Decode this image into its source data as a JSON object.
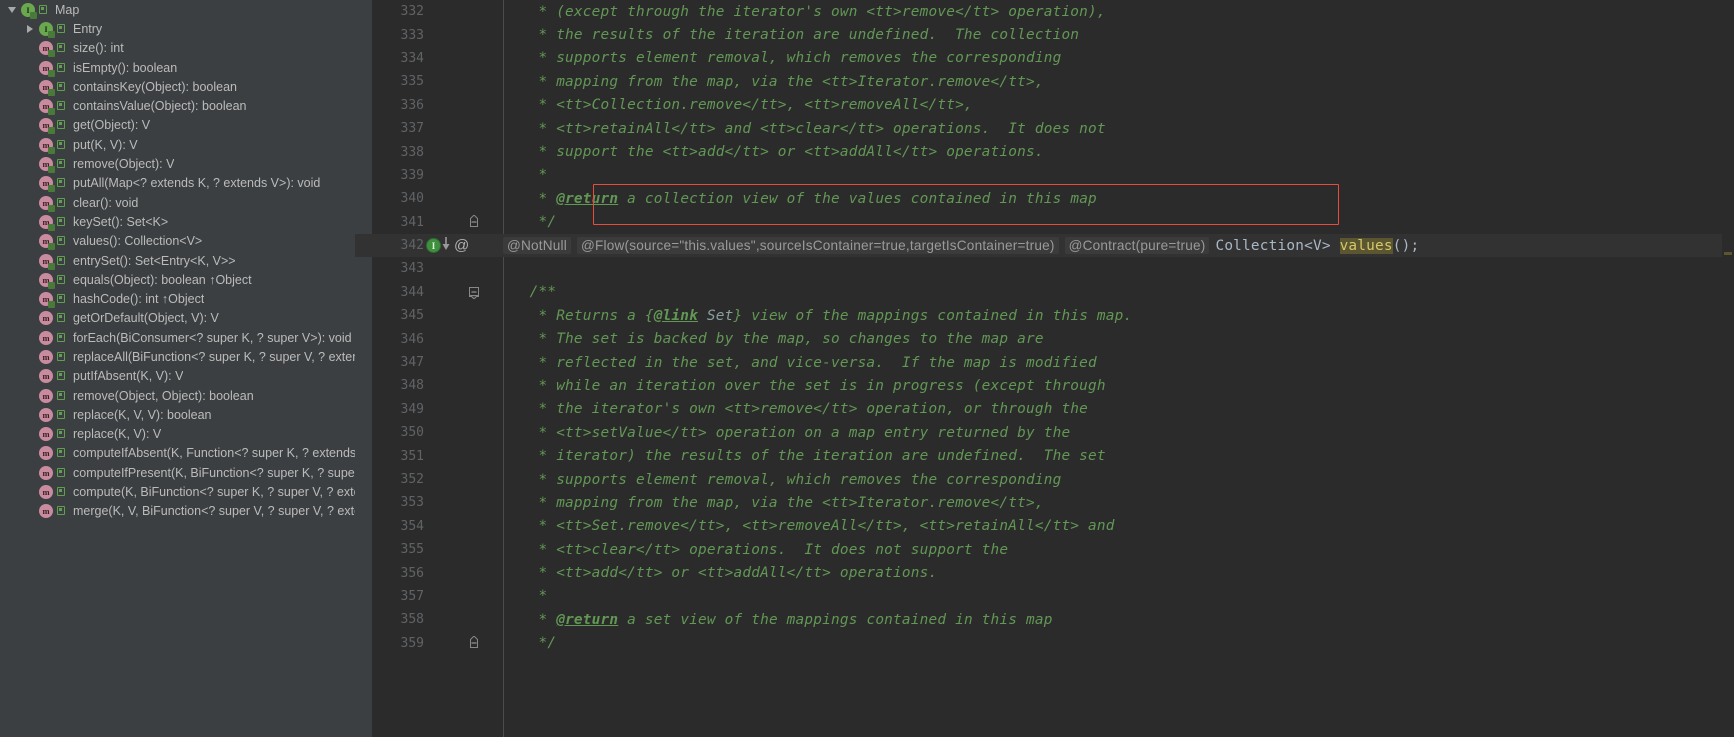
{
  "structure_panel": {
    "name": "structure-tree",
    "items": [
      {
        "indent": 0,
        "twisty": "expanded",
        "icon": "interface-icon",
        "visibility": "public-icon",
        "label": "Map"
      },
      {
        "indent": 1,
        "twisty": "collapsed",
        "icon": "interface-icon",
        "visibility": "public-icon",
        "label": "Entry"
      },
      {
        "indent": 1,
        "twisty": "none",
        "icon": "method-abstract-icon",
        "visibility": "public-icon",
        "label": "size(): int"
      },
      {
        "indent": 1,
        "twisty": "none",
        "icon": "method-abstract-icon",
        "visibility": "public-icon",
        "label": "isEmpty(): boolean"
      },
      {
        "indent": 1,
        "twisty": "none",
        "icon": "method-abstract-icon",
        "visibility": "public-icon",
        "label": "containsKey(Object): boolean"
      },
      {
        "indent": 1,
        "twisty": "none",
        "icon": "method-abstract-icon",
        "visibility": "public-icon",
        "label": "containsValue(Object): boolean"
      },
      {
        "indent": 1,
        "twisty": "none",
        "icon": "method-abstract-icon",
        "visibility": "public-icon",
        "label": "get(Object): V"
      },
      {
        "indent": 1,
        "twisty": "none",
        "icon": "method-abstract-icon",
        "visibility": "public-icon",
        "label": "put(K, V): V"
      },
      {
        "indent": 1,
        "twisty": "none",
        "icon": "method-abstract-icon",
        "visibility": "public-icon",
        "label": "remove(Object): V"
      },
      {
        "indent": 1,
        "twisty": "none",
        "icon": "method-abstract-icon",
        "visibility": "public-icon",
        "label": "putAll(Map<? extends K, ? extends V>): void"
      },
      {
        "indent": 1,
        "twisty": "none",
        "icon": "method-abstract-icon",
        "visibility": "public-icon",
        "label": "clear(): void"
      },
      {
        "indent": 1,
        "twisty": "none",
        "icon": "method-abstract-icon",
        "visibility": "public-icon",
        "label": "keySet(): Set<K>"
      },
      {
        "indent": 1,
        "twisty": "none",
        "icon": "method-abstract-icon",
        "visibility": "public-icon",
        "label": "values(): Collection<V>"
      },
      {
        "indent": 1,
        "twisty": "none",
        "icon": "method-abstract-icon",
        "visibility": "public-icon",
        "label": "entrySet(): Set<Entry<K, V>>"
      },
      {
        "indent": 1,
        "twisty": "none",
        "icon": "method-abstract-icon",
        "visibility": "public-icon",
        "label": "equals(Object): boolean ↑Object"
      },
      {
        "indent": 1,
        "twisty": "none",
        "icon": "method-abstract-icon",
        "visibility": "public-icon",
        "label": "hashCode(): int ↑Object"
      },
      {
        "indent": 1,
        "twisty": "none",
        "icon": "method-icon",
        "visibility": "public-icon",
        "label": "getOrDefault(Object, V): V"
      },
      {
        "indent": 1,
        "twisty": "none",
        "icon": "method-icon",
        "visibility": "public-icon",
        "label": "forEach(BiConsumer<? super K, ? super V>): void"
      },
      {
        "indent": 1,
        "twisty": "none",
        "icon": "method-icon",
        "visibility": "public-icon",
        "label": "replaceAll(BiFunction<? super K, ? super V, ? extends V>): void"
      },
      {
        "indent": 1,
        "twisty": "none",
        "icon": "method-icon",
        "visibility": "public-icon",
        "label": "putIfAbsent(K, V): V"
      },
      {
        "indent": 1,
        "twisty": "none",
        "icon": "method-icon",
        "visibility": "public-icon",
        "label": "remove(Object, Object): boolean"
      },
      {
        "indent": 1,
        "twisty": "none",
        "icon": "method-icon",
        "visibility": "public-icon",
        "label": "replace(K, V, V): boolean"
      },
      {
        "indent": 1,
        "twisty": "none",
        "icon": "method-icon",
        "visibility": "public-icon",
        "label": "replace(K, V): V"
      },
      {
        "indent": 1,
        "twisty": "none",
        "icon": "method-icon",
        "visibility": "public-icon",
        "label": "computeIfAbsent(K, Function<? super K, ? extends V>): V"
      },
      {
        "indent": 1,
        "twisty": "none",
        "icon": "method-icon",
        "visibility": "public-icon",
        "label": "computeIfPresent(K, BiFunction<? super K, ? super V, ? extends V>): V"
      },
      {
        "indent": 1,
        "twisty": "none",
        "icon": "method-icon",
        "visibility": "public-icon",
        "label": "compute(K, BiFunction<? super K, ? super V, ? extends V>): V"
      },
      {
        "indent": 1,
        "twisty": "none",
        "icon": "method-icon",
        "visibility": "public-icon",
        "label": "merge(K, V, BiFunction<? super V, ? super V, ? extends V>): V"
      }
    ]
  },
  "editor": {
    "name": "java-source-editor",
    "lines": [
      {
        "no": "332",
        "segments": [
          {
            "cls": "cmt",
            "t": "* (except through the iterator's own <tt>remove</tt> operation),"
          }
        ]
      },
      {
        "no": "333",
        "segments": [
          {
            "cls": "cmt",
            "t": "* the results of the iteration are undefined.  The collection"
          }
        ]
      },
      {
        "no": "334",
        "segments": [
          {
            "cls": "cmt",
            "t": "* supports element removal, which removes the corresponding"
          }
        ]
      },
      {
        "no": "335",
        "segments": [
          {
            "cls": "cmt",
            "t": "* mapping from the map, via the <tt>Iterator.remove</tt>,"
          }
        ]
      },
      {
        "no": "336",
        "segments": [
          {
            "cls": "cmt",
            "t": "* <tt>Collection.remove</tt>, <tt>removeAll</tt>,"
          }
        ]
      },
      {
        "no": "337",
        "segments": [
          {
            "cls": "cmt",
            "t": "* <tt>retainAll</tt> and <tt>clear</tt> operations.  It does not"
          }
        ]
      },
      {
        "no": "338",
        "segments": [
          {
            "cls": "cmt",
            "t": "* support the <tt>add</tt> or <tt>addAll</tt> operations."
          }
        ]
      },
      {
        "no": "339",
        "segments": [
          {
            "cls": "cmt",
            "t": "*"
          }
        ]
      },
      {
        "no": "340",
        "segments": [
          {
            "cls": "cmt",
            "t": "* "
          },
          {
            "cls": "cmt-tag",
            "t": "@return"
          },
          {
            "cls": "cmt",
            "t": " a collection view of the values contained in this map"
          }
        ]
      },
      {
        "no": "341",
        "fold": "end",
        "segments": [
          {
            "cls": "cmt",
            "t": "*/"
          }
        ]
      },
      {
        "no": "342",
        "kind": "signature"
      },
      {
        "no": "343",
        "segments": []
      },
      {
        "no": "344",
        "fold": "start",
        "segments": [
          {
            "cls": "cmt",
            "t": "/**"
          }
        ]
      },
      {
        "no": "345",
        "segments": [
          {
            "cls": "cmt",
            "t": "* Returns a {"
          },
          {
            "cls": "cmt-link",
            "t": "@link"
          },
          {
            "cls": "cmt-ref",
            "t": " Set"
          },
          {
            "cls": "cmt",
            "t": "} view of the mappings contained in this map."
          }
        ]
      },
      {
        "no": "346",
        "segments": [
          {
            "cls": "cmt",
            "t": "* The set is backed by the map, so changes to the map are"
          }
        ]
      },
      {
        "no": "347",
        "segments": [
          {
            "cls": "cmt",
            "t": "* reflected in the set, and vice-versa.  If the map is modified"
          }
        ]
      },
      {
        "no": "348",
        "segments": [
          {
            "cls": "cmt",
            "t": "* while an iteration over the set is in progress (except through"
          }
        ]
      },
      {
        "no": "349",
        "segments": [
          {
            "cls": "cmt",
            "t": "* the iterator's own <tt>remove</tt> operation, or through the"
          }
        ]
      },
      {
        "no": "350",
        "segments": [
          {
            "cls": "cmt",
            "t": "* <tt>setValue</tt> operation on a map entry returned by the"
          }
        ]
      },
      {
        "no": "351",
        "segments": [
          {
            "cls": "cmt",
            "t": "* iterator) the results of the iteration are undefined.  The set"
          }
        ]
      },
      {
        "no": "352",
        "segments": [
          {
            "cls": "cmt",
            "t": "* supports element removal, which removes the corresponding"
          }
        ]
      },
      {
        "no": "353",
        "segments": [
          {
            "cls": "cmt",
            "t": "* mapping from the map, via the <tt>Iterator.remove</tt>,"
          }
        ]
      },
      {
        "no": "354",
        "segments": [
          {
            "cls": "cmt",
            "t": "* <tt>Set.remove</tt>, <tt>removeAll</tt>, <tt>retainAll</tt> and"
          }
        ]
      },
      {
        "no": "355",
        "segments": [
          {
            "cls": "cmt",
            "t": "* <tt>clear</tt> operations.  It does not support the"
          }
        ]
      },
      {
        "no": "356",
        "segments": [
          {
            "cls": "cmt",
            "t": "* <tt>add</tt> or <tt>addAll</tt> operations."
          }
        ]
      },
      {
        "no": "357",
        "segments": [
          {
            "cls": "cmt",
            "t": "*"
          }
        ]
      },
      {
        "no": "358",
        "segments": [
          {
            "cls": "cmt",
            "t": "* "
          },
          {
            "cls": "cmt-tag",
            "t": "@return"
          },
          {
            "cls": "cmt",
            "t": " a set view of the mappings contained in this map"
          }
        ]
      },
      {
        "no": "359",
        "fold": "end",
        "segments": [
          {
            "cls": "cmt",
            "t": "*/"
          }
        ]
      }
    ],
    "signature_line": {
      "gutter_bulb": "intention-bulb-icon",
      "gutter_bulb_letter": "I",
      "gutter_at": "@",
      "annotations": [
        "@NotNull",
        "@Flow(source=\"this.values\",sourceIsContainer=true,targetIsContainer=true)",
        "@Contract(pure=true)"
      ],
      "return_type": "Collection<V>",
      "method_name": "values",
      "tail": "();"
    },
    "annotations_overlay": {
      "return_highlight": {
        "name": "return-text-highlight-box",
        "color": "#e74c3c"
      }
    }
  },
  "colors": {
    "panel_bg": "#3c3f41",
    "editor_bg": "#2b2b2b",
    "comment_green": "#629755",
    "lineno_gray": "#606366",
    "highlight_red": "#e74c3c",
    "search_highlight": "#5b5530",
    "caret_row": "#323232"
  }
}
